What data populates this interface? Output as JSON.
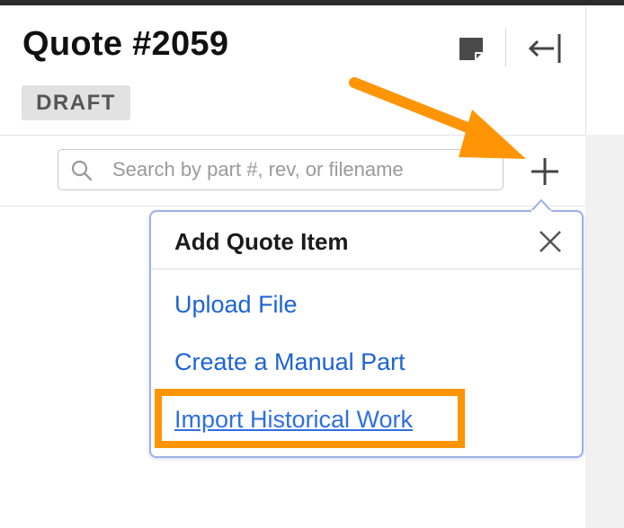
{
  "header": {
    "title": "Quote #2059",
    "status_badge": "DRAFT",
    "note_icon": "sticky-note-icon",
    "collapse_icon": "collapse-left-icon"
  },
  "search": {
    "placeholder": "Search by part #, rev, or filename",
    "value": ""
  },
  "add_button": {
    "icon": "plus-icon"
  },
  "popover": {
    "title": "Add Quote Item",
    "close_icon": "close-icon",
    "items": [
      {
        "label": "Upload File"
      },
      {
        "label": "Create a Manual Part"
      },
      {
        "label": "Import Historical Work"
      }
    ]
  },
  "colors": {
    "link": "#1d63d6",
    "annotation": "#ff9505",
    "popover_border": "#9fb0e6"
  }
}
